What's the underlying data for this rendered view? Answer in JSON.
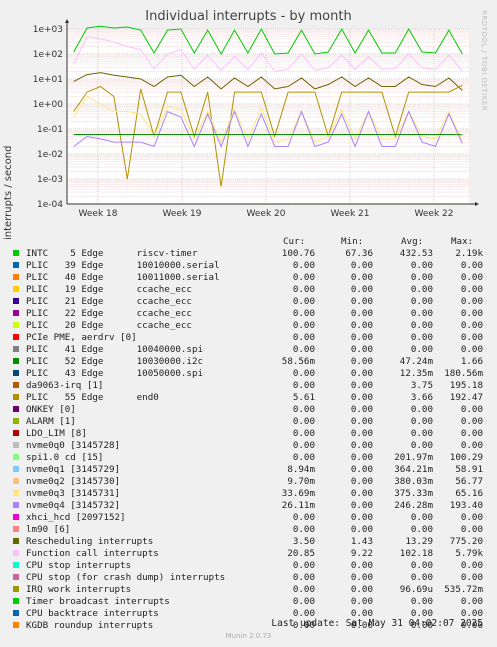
{
  "title": "Individual interrupts - by month",
  "watermark": "RRDTOOL / TOBI OETIKER",
  "last_update": "Last update: Sat May 31 04:02:07 2025",
  "footer": "Munin 2.0.73",
  "legend_headers": {
    "cur": "Cur:",
    "min": "Min:",
    "avg": "Avg:",
    "max": "Max:"
  },
  "legend": [
    {
      "name": "INTC    5 Edge      riscv-timer",
      "color": "#00cc00",
      "cur": "100.76",
      "min": "67.36",
      "avg": "432.53",
      "max": "2.19k"
    },
    {
      "name": "PLIC   39 Edge      10010000.serial",
      "color": "#0066b3",
      "cur": "0.00",
      "min": "0.00",
      "avg": "0.00",
      "max": "0.00"
    },
    {
      "name": "PLIC   40 Edge      10011000.serial",
      "color": "#ff8000",
      "cur": "0.00",
      "min": "0.00",
      "avg": "0.00",
      "max": "0.00"
    },
    {
      "name": "PLIC   19 Edge      ccache_ecc",
      "color": "#ffcc00",
      "cur": "0.00",
      "min": "0.00",
      "avg": "0.00",
      "max": "0.00"
    },
    {
      "name": "PLIC   21 Edge      ccache_ecc",
      "color": "#330099",
      "cur": "0.00",
      "min": "0.00",
      "avg": "0.00",
      "max": "0.00"
    },
    {
      "name": "PLIC   22 Edge      ccache_ecc",
      "color": "#990099",
      "cur": "0.00",
      "min": "0.00",
      "avg": "0.00",
      "max": "0.00"
    },
    {
      "name": "PLIC   20 Edge      ccache_ecc",
      "color": "#ccff00",
      "cur": "0.00",
      "min": "0.00",
      "avg": "0.00",
      "max": "0.00"
    },
    {
      "name": "PCIe PME, aerdrv [0]",
      "color": "#ff0000",
      "cur": "0.00",
      "min": "0.00",
      "avg": "0.00",
      "max": "0.00"
    },
    {
      "name": "PLIC   41 Edge      10040000.spi",
      "color": "#808080",
      "cur": "0.00",
      "min": "0.00",
      "avg": "0.00",
      "max": "0.00"
    },
    {
      "name": "PLIC   52 Edge      10030000.i2c",
      "color": "#008f00",
      "cur": "58.56m",
      "min": "0.00",
      "avg": "47.24m",
      "max": "1.66"
    },
    {
      "name": "PLIC   43 Edge      10050000.spi",
      "color": "#00487d",
      "cur": "0.00",
      "min": "0.00",
      "avg": "12.35m",
      "max": "180.56m"
    },
    {
      "name": "da9063-irq [1]",
      "color": "#b35a00",
      "cur": "0.00",
      "min": "0.00",
      "avg": "3.75",
      "max": "195.18"
    },
    {
      "name": "PLIC   55 Edge      end0",
      "color": "#b38f00",
      "cur": "5.61",
      "min": "0.00",
      "avg": "3.66",
      "max": "192.47"
    },
    {
      "name": "ONKEY [0]",
      "color": "#6b006b",
      "cur": "0.00",
      "min": "0.00",
      "avg": "0.00",
      "max": "0.00"
    },
    {
      "name": "ALARM [1]",
      "color": "#8fb300",
      "cur": "0.00",
      "min": "0.00",
      "avg": "0.00",
      "max": "0.00"
    },
    {
      "name": "LDO_LIM [8]",
      "color": "#b30000",
      "cur": "0.00",
      "min": "0.00",
      "avg": "0.00",
      "max": "0.00"
    },
    {
      "name": "nvme0q0 [3145728]",
      "color": "#bebebe",
      "cur": "0.00",
      "min": "0.00",
      "avg": "0.00",
      "max": "0.00"
    },
    {
      "name": "spi1.0 cd [15]",
      "color": "#80ff80",
      "cur": "0.00",
      "min": "0.00",
      "avg": "201.97m",
      "max": "100.29"
    },
    {
      "name": "nvme0q1 [3145729]",
      "color": "#80c9ff",
      "cur": "8.94m",
      "min": "0.00",
      "avg": "364.21m",
      "max": "58.91"
    },
    {
      "name": "nvme0q2 [3145730]",
      "color": "#ffc080",
      "cur": "9.70m",
      "min": "0.00",
      "avg": "380.03m",
      "max": "56.77"
    },
    {
      "name": "nvme0q3 [3145731]",
      "color": "#ffe680",
      "cur": "33.69m",
      "min": "0.00",
      "avg": "375.33m",
      "max": "65.16"
    },
    {
      "name": "nvme0q4 [3145732]",
      "color": "#aa80ff",
      "cur": "26.11m",
      "min": "0.00",
      "avg": "246.28m",
      "max": "193.40"
    },
    {
      "name": "xhci_hcd [2097152]",
      "color": "#ee00cc",
      "cur": "0.00",
      "min": "0.00",
      "avg": "0.00",
      "max": "0.00"
    },
    {
      "name": "lm90 [6]",
      "color": "#ff8080",
      "cur": "0.00",
      "min": "0.00",
      "avg": "0.00",
      "max": "0.00"
    },
    {
      "name": "Rescheduling interrupts",
      "color": "#666600",
      "cur": "3.50",
      "min": "1.43",
      "avg": "13.29",
      "max": "775.20"
    },
    {
      "name": "Function call interrupts",
      "color": "#ffbfff",
      "cur": "20.85",
      "min": "9.22",
      "avg": "102.18",
      "max": "5.79k"
    },
    {
      "name": "CPU stop interrupts",
      "color": "#00ffcc",
      "cur": "0.00",
      "min": "0.00",
      "avg": "0.00",
      "max": "0.00"
    },
    {
      "name": "CPU stop (for crash dump) interrupts",
      "color": "#cc6699",
      "cur": "0.00",
      "min": "0.00",
      "avg": "0.00",
      "max": "0.00"
    },
    {
      "name": "IRQ work interrupts",
      "color": "#999900",
      "cur": "0.00",
      "min": "0.00",
      "avg": "96.69u",
      "max": "535.72m"
    },
    {
      "name": "Timer broadcast interrupts",
      "color": "#00cc00",
      "cur": "0.00",
      "min": "0.00",
      "avg": "0.00",
      "max": "0.00"
    },
    {
      "name": "CPU backtrace interrupts",
      "color": "#0066b3",
      "cur": "0.00",
      "min": "0.00",
      "avg": "0.00",
      "max": "0.00"
    },
    {
      "name": "KGDB roundup interrupts",
      "color": "#ff8000",
      "cur": "0.00",
      "min": "0.00",
      "avg": "0.00",
      "max": "0.00"
    }
  ],
  "chart_data": {
    "type": "line",
    "title": "Individual interrupts - by month",
    "ylabel": "interrupts / second",
    "xlabel": "",
    "y_scale": "log",
    "ylim": [
      0.0001,
      1000
    ],
    "y_ticks": [
      "1e-04",
      "1e-03",
      "1e-02",
      "1e-01",
      "1e+00",
      "1e+01",
      "1e+02",
      "1e+03"
    ],
    "x_ticks": [
      "Week 18",
      "Week 19",
      "Week 20",
      "Week 21",
      "Week 22"
    ],
    "grid": true,
    "series": [
      {
        "name": "INTC    5 Edge      riscv-timer",
        "color": "#00cc00",
        "values": [
          120,
          1100,
          1300,
          1100,
          1200,
          900,
          110,
          900,
          1000,
          110,
          900,
          100,
          900,
          110,
          1000,
          100,
          110,
          900,
          100,
          120,
          1000,
          110,
          900,
          110,
          110,
          1000,
          120,
          110,
          900,
          100
        ]
      },
      {
        "name": "Function call interrupts",
        "color": "#ffbfff",
        "values": [
          40,
          500,
          400,
          300,
          200,
          150,
          25,
          100,
          150,
          25,
          90,
          22,
          80,
          24,
          110,
          20,
          25,
          100,
          22,
          28,
          90,
          24,
          80,
          25,
          26,
          100,
          28,
          24,
          90,
          21
        ]
      },
      {
        "name": "Rescheduling interrupts",
        "color": "#666600",
        "values": [
          8,
          15,
          18,
          14,
          12,
          10,
          5,
          12,
          14,
          5,
          12,
          4,
          11,
          5,
          12,
          4,
          5,
          11,
          4,
          6,
          12,
          5,
          11,
          5,
          5,
          12,
          6,
          5,
          11,
          3.5
        ]
      },
      {
        "name": "PLIC   55 Edge      end0",
        "color": "#b38f00",
        "values": [
          0.5,
          3,
          5,
          2,
          0.001,
          4,
          0.05,
          3,
          3,
          0.05,
          3,
          0.0005,
          3,
          3,
          3,
          0.05,
          3,
          3,
          3,
          0.05,
          3,
          3,
          3,
          3,
          0.05,
          3,
          3,
          3,
          3,
          5.61
        ]
      },
      {
        "name": "nvme0q3 [3145731]",
        "color": "#ffe680",
        "values": [
          0.3,
          2,
          1,
          0.5,
          0.5,
          0.4,
          0.05,
          0.8,
          0.6,
          0.04,
          0.5,
          0.03,
          0.6,
          0.04,
          0.7,
          0.03,
          0.04,
          0.5,
          0.03,
          0.05,
          0.6,
          0.04,
          0.5,
          0.04,
          0.04,
          0.5,
          0.05,
          0.04,
          0.5,
          0.034
        ]
      },
      {
        "name": "nvme0q4 [3145732]",
        "color": "#aa80ff",
        "values": [
          0.02,
          0.05,
          0.04,
          0.03,
          0.03,
          0.03,
          0.02,
          0.5,
          0.3,
          0.02,
          0.4,
          0.02,
          0.5,
          0.02,
          0.4,
          0.02,
          0.02,
          0.5,
          0.02,
          0.03,
          0.4,
          0.02,
          0.5,
          0.02,
          0.02,
          0.5,
          0.03,
          0.02,
          0.4,
          0.026
        ]
      },
      {
        "name": "PLIC   52 Edge      10030000.i2c",
        "color": "#008f00",
        "values": [
          0.06,
          0.06,
          0.06,
          0.06,
          0.06,
          0.06,
          0.06,
          0.06,
          0.06,
          0.06,
          0.06,
          0.06,
          0.06,
          0.06,
          0.06,
          0.06,
          0.06,
          0.06,
          0.06,
          0.06,
          0.06,
          0.06,
          0.06,
          0.06,
          0.06,
          0.06,
          0.06,
          0.06,
          0.06,
          0.0586
        ]
      }
    ]
  }
}
